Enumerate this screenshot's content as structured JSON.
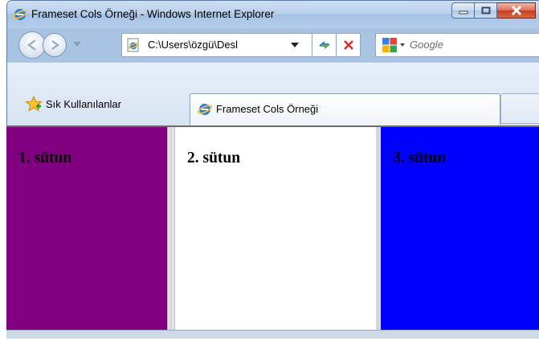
{
  "window": {
    "title": "Frameset Cols Örneği - Windows Internet Explorer"
  },
  "navbar": {
    "address_value": "C:\\Users\\özgü\\Desl",
    "search_placeholder": "Google"
  },
  "favorites": {
    "label": "Sık Kullanılanlar"
  },
  "tab": {
    "label": "Frameset Cols Örneği"
  },
  "frames": [
    {
      "heading": "1. sütun",
      "background": "#800080"
    },
    {
      "heading": "2. sütun",
      "background": "#ffffff"
    },
    {
      "heading": "3. sütun",
      "background": "#0000ff"
    }
  ],
  "icons": {
    "title": "ie-logo-icon",
    "minimize": "minimize-icon",
    "maximize": "maximize-icon",
    "close": "close-icon",
    "back": "back-arrow-icon",
    "forward": "forward-arrow-icon",
    "refresh": "refresh-icon",
    "stop": "stop-icon",
    "search_provider": "google-logo-icon",
    "favorites": "star-icon"
  }
}
